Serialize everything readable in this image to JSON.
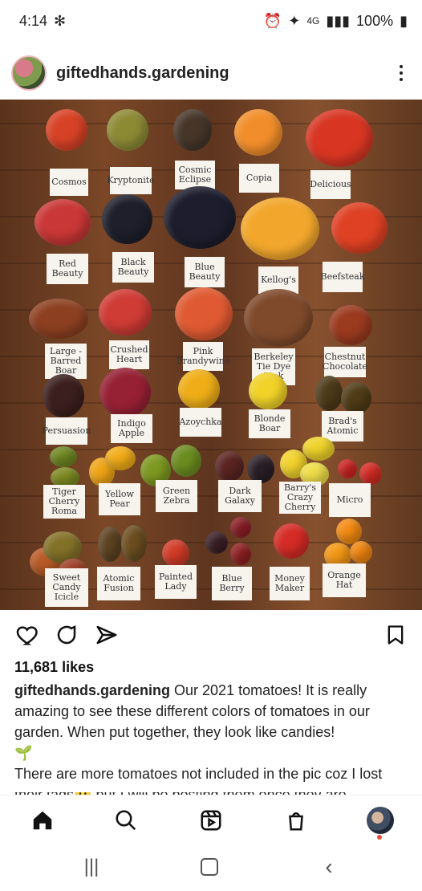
{
  "status": {
    "time": "4:14",
    "battery": "100%",
    "network": "4G"
  },
  "post": {
    "username": "giftedhands.gardening",
    "likes": "11,681 likes",
    "caption_user": "giftedhands.gardening",
    "caption_text": "Our 2021 tomatoes! It is really amazing to see these different colors of tomatoes in our garden. When put together, they look like candies!",
    "caption_leaf": "🌱",
    "caption_more": "There are more tomatoes not included in the pic coz I lost their tags😢 but I will be posting them once they are"
  },
  "labels": [
    "Cosmos",
    "Kryptonite",
    "Cosmic\nEclipse",
    "Copia",
    "Delicious",
    "Red\nBeauty",
    "Black\nBeauty",
    "Blue\nBeauty",
    "Kellog's",
    "Beefsteak",
    "Large -\nBarred\nBoar",
    "Crushed\nHeart",
    "Pink\nBrandywine",
    "Berkeley\nTie Dye\nPink",
    "Chestnut\nChocolate",
    "Persuasion",
    "Indigo\nApple",
    "Azoychka",
    "Blonde\nBoar",
    "Brad's\nAtomic",
    "Tiger Cherry\nRoma",
    "Yellow\nPear",
    "Green\nZebra",
    "Dark\nGalaxy",
    "Barry's\nCrazy\nCherry",
    "Micro",
    "Sweet\nCandy\nIcicle",
    "Atomic\nFusion",
    "Painted\nLady",
    "Blue\nBerry",
    "Money\nMaker",
    "Orange\nHat"
  ],
  "colors": {
    "text": "#111111",
    "leaf": "#58a33b",
    "accent_red": "#e74b3c"
  }
}
